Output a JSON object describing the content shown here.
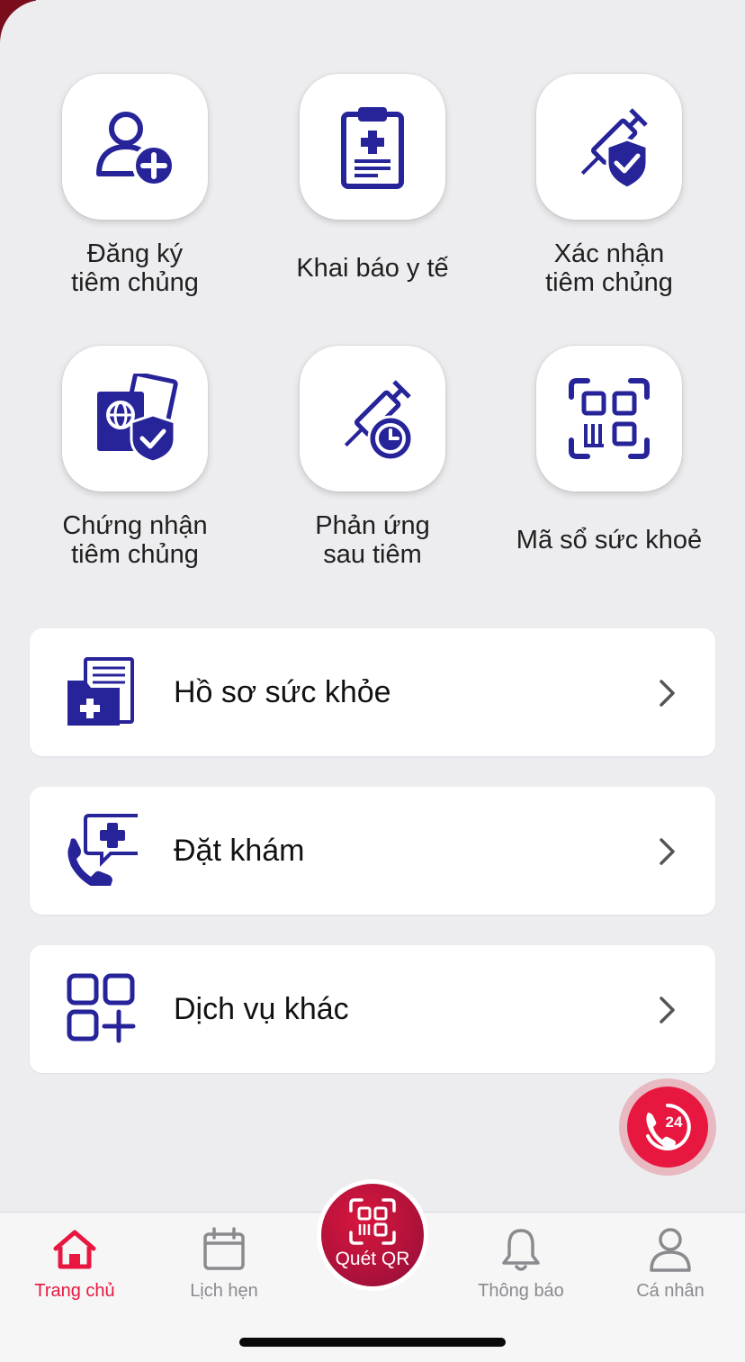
{
  "colors": {
    "accent_blue": "#27249a",
    "accent_red": "#e8173f",
    "background": "#ededf0"
  },
  "grid": [
    {
      "label": "Đăng ký\ntiêm chủng",
      "icon": "user-add-icon"
    },
    {
      "label": "Khai báo y tế",
      "icon": "clipboard-medical-icon"
    },
    {
      "label": "Xác nhận\ntiêm chủng",
      "icon": "syringe-shield-icon"
    },
    {
      "label": "Chứng nhận\ntiêm chủng",
      "icon": "passport-shield-icon"
    },
    {
      "label": "Phản ứng\nsau tiêm",
      "icon": "syringe-clock-icon"
    },
    {
      "label": "Mã sổ sức khoẻ",
      "icon": "qr-code-icon"
    }
  ],
  "menu": [
    {
      "label": "Hồ sơ sức khỏe",
      "icon": "medical-folder-icon"
    },
    {
      "label": "Đặt khám",
      "icon": "phone-medical-chat-icon"
    },
    {
      "label": "Dịch vụ khác",
      "icon": "grid-add-icon"
    }
  ],
  "hotline": {
    "label": "24",
    "icon": "hotline-24-icon"
  },
  "tabbar": {
    "items": [
      {
        "label": "Trang chủ",
        "icon": "home-icon",
        "active": true
      },
      {
        "label": "Lịch hẹn",
        "icon": "calendar-icon",
        "active": false
      },
      {
        "label": "Thông báo",
        "icon": "bell-icon",
        "active": false
      },
      {
        "label": "Cá nhân",
        "icon": "person-icon",
        "active": false
      }
    ],
    "scan": {
      "label": "Quét QR",
      "icon": "qr-scan-icon"
    }
  }
}
